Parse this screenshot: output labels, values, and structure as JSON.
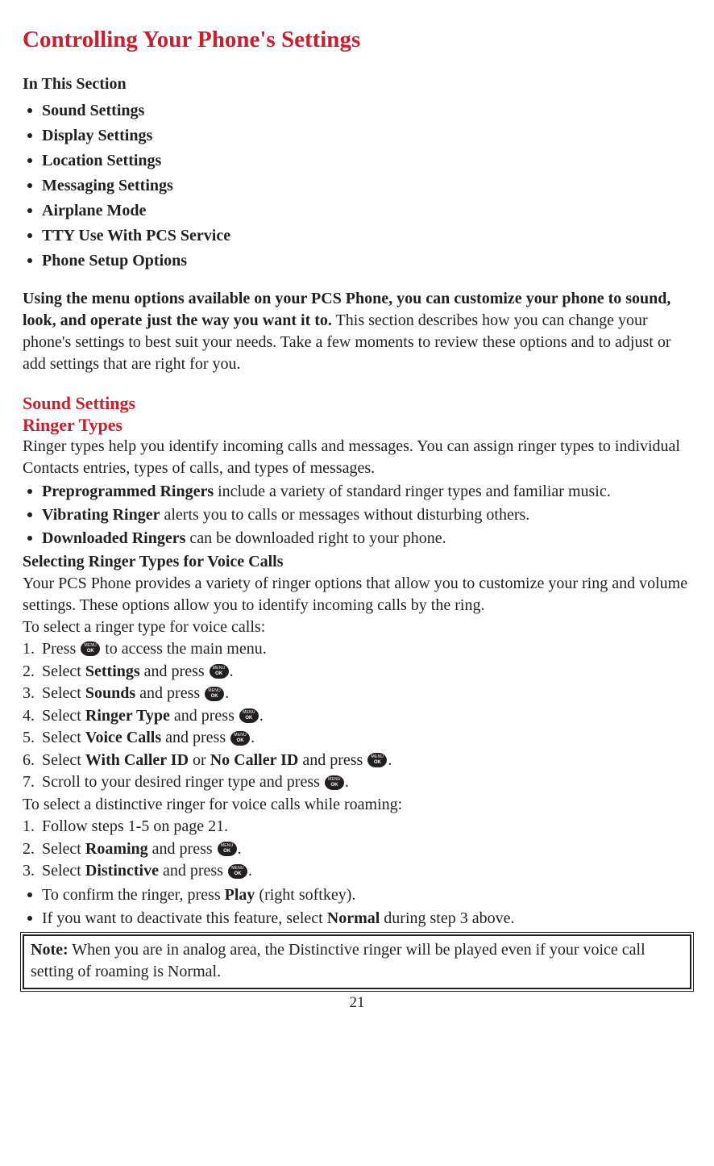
{
  "title": "Controlling Your Phone's Settings",
  "in_this_section_label": "In This Section",
  "toc": [
    "Sound Settings",
    "Display Settings",
    "Location Settings",
    "Messaging Settings",
    "Airplane Mode",
    "TTY Use With PCS Service",
    "Phone Setup Options"
  ],
  "intro_lead": "Using the menu options available on your PCS Phone, you can customize your phone to sound, look, and operate just the way you want it to.",
  "intro_rest": " This section describes how you can change your phone's settings to best suit your needs. Take a few moments to review these options and to adjust or add settings that are right for you.",
  "section_sound": "Sound Settings",
  "section_ringer_types": "Ringer Types",
  "ringer_types_para": "Ringer types help you identify incoming calls and messages. You can assign ringer types to individual Contacts entries, types of calls, and types of messages.",
  "ringer_bullets": {
    "pre_bold": "Preprogrammed Ringers",
    "pre_rest": " include a variety of standard ringer types and familiar music.",
    "vib_bold": "Vibrating Ringer",
    "vib_rest": " alerts you to calls or messages without disturbing others.",
    "dl_bold": "Downloaded Ringers",
    "dl_rest": " can be downloaded right to your phone."
  },
  "selecting_heading": "Selecting Ringer Types for Voice Calls",
  "selecting_para": "Your PCS Phone provides a variety of ringer options that allow you to customize your ring and volume settings. These options allow you to identify incoming calls by the ring.",
  "to_select_voice": "To select a ringer type for voice calls:",
  "steps_voice": {
    "s1a": "Press ",
    "s1b": " to access the main menu.",
    "s2a": "Select ",
    "s2b": "Settings",
    "s2c": " and press ",
    "s3a": "Select ",
    "s3b": "Sounds",
    "s3c": " and press ",
    "s4a": "Select ",
    "s4b": "Ringer Type",
    "s4c": " and press ",
    "s5a": "Select ",
    "s5b": "Voice Calls",
    "s5c": " and press ",
    "s6a": "Select ",
    "s6b": "With Caller ID",
    "s6c": " or ",
    "s6d": "No Caller ID",
    "s6e": " and press ",
    "s7a": "Scroll to your desired ringer type and press "
  },
  "to_select_roaming": "To select a distinctive ringer for voice calls while roaming:",
  "steps_roam": {
    "r1": "Follow steps 1-5 on page 21.",
    "r2a": "Select ",
    "r2b": "Roaming",
    "r2c": " and press ",
    "r3a": "Select ",
    "r3b": "Distinctive",
    "r3c": " and press "
  },
  "post_bullets": {
    "p1a": "To confirm the ringer, press ",
    "p1b": "Play",
    "p1c": " (right softkey).",
    "p2a": "If you want to deactivate this feature, select ",
    "p2b": "Normal",
    "p2c": " during step 3 above."
  },
  "note_bold": "Note:",
  "note_rest": " When you are in analog area, the Distinctive ringer will be played even if your voice call setting of roaming is Normal.",
  "page_number": "21",
  "period": "."
}
